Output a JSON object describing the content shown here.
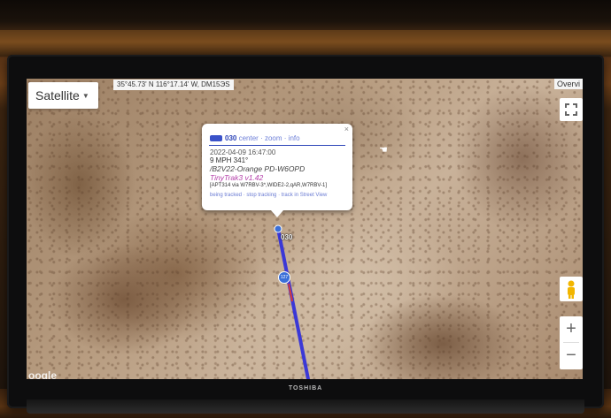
{
  "tv": {
    "brand": "TOSHIBA"
  },
  "map": {
    "map_type_label": "Satellite",
    "coordinates_text": "35°45.73' N 116°17.14' W, DM15ЭS",
    "overview_label": "Overvi",
    "watermark": "oogle",
    "marker_label": "030",
    "highway_shield": "127",
    "route_color": "#3b38d6"
  },
  "popup": {
    "callsign": "030",
    "links": {
      "center": "center",
      "zoom": "zoom",
      "info": "info",
      "sep": "·"
    },
    "close_glyph": "×",
    "timestamp": "2022-04-09 16:47:00",
    "speed_course": "9 MPH 341°",
    "comment": "/B2V22-Orange PD-W6OPD",
    "device": "TinyTrak3 v1.42",
    "path": "[APT314 via W7RBV-3*,WIDE2-2,qAR,W7RBV-1]",
    "actions": {
      "status": "being tracked",
      "stop": "stop tracking",
      "street": "track in Street View",
      "sep": "·"
    }
  },
  "controls": {
    "zoom_in": "+",
    "zoom_out": "−"
  }
}
